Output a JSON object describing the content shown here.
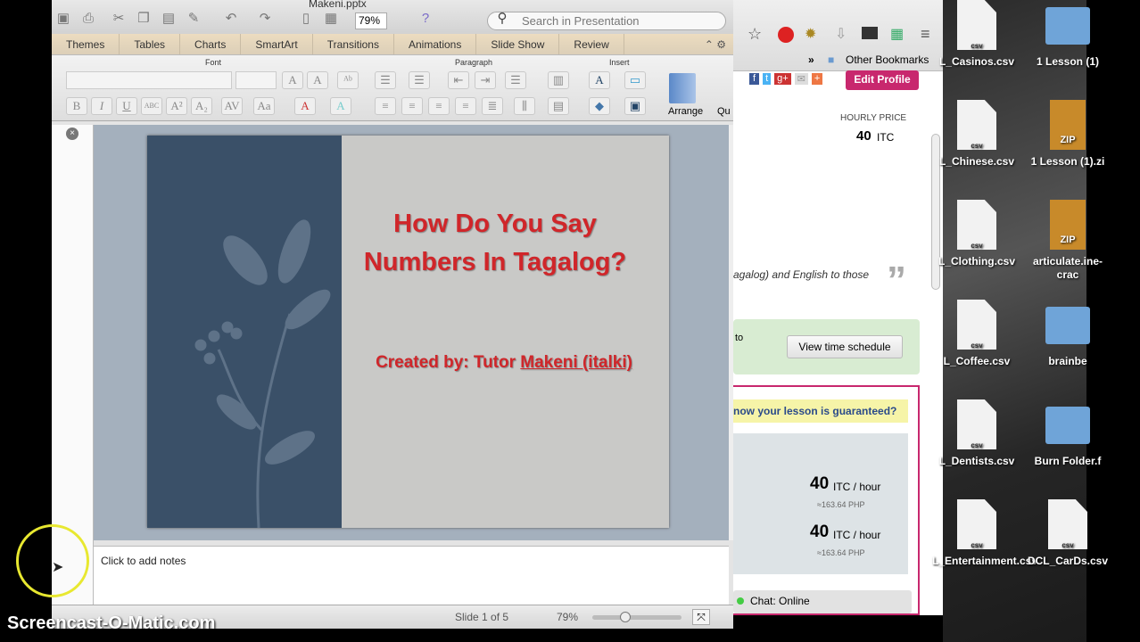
{
  "ppt": {
    "window_title": "Makeni.pptx",
    "zoom": "79%",
    "search_placeholder": "Search in Presentation",
    "tabs": [
      "Themes",
      "Tables",
      "Charts",
      "SmartArt",
      "Transitions",
      "Animations",
      "Slide Show",
      "Review"
    ],
    "groups": {
      "font": "Font",
      "paragraph": "Paragraph",
      "insert": "Insert"
    },
    "arrange": "Arrange",
    "quick": "Qu",
    "slide": {
      "title": "How Do You Say Numbers In Tagalog?",
      "credit_prefix": "Created by: Tutor ",
      "credit_link": "Makeni (italki)"
    },
    "notes_placeholder": "Click to add notes",
    "status": {
      "slide": "Slide 1 of 5",
      "zoom": "79%",
      "zoom_level": 0.35
    }
  },
  "browser": {
    "other_bookmarks": "Other Bookmarks",
    "edit_profile": "Edit Profile",
    "hourly_label": "HOURLY PRICE",
    "hourly_value": "40",
    "hourly_unit": "ITC",
    "quote_fragment": "agalog) and English to those",
    "to": "to",
    "view_schedule": "View time schedule",
    "guarantee": "now your lesson is guaranteed?",
    "prices": [
      {
        "value": "40",
        "unit": "ITC / hour",
        "php": "≈163.64 PHP"
      },
      {
        "value": "40",
        "unit": "ITC / hour",
        "php": "≈163.64 PHP"
      }
    ],
    "chat": "Chat: Online",
    "accent": "#c8286e"
  },
  "desktop": {
    "items": [
      {
        "label": "L_Casinos.csv",
        "type": "csv"
      },
      {
        "label": "1 Lesson (1)",
        "type": "folder"
      },
      {
        "label": "L_Chinese.csv",
        "type": "csv"
      },
      {
        "label": "1 Lesson (1).zi",
        "type": "zip"
      },
      {
        "label": "L_Clothing.csv",
        "type": "csv"
      },
      {
        "label": "articulate.ine-crac",
        "type": "zip"
      },
      {
        "label": "L_Coffee.csv",
        "type": "csv"
      },
      {
        "label": "brainbe",
        "type": "folder"
      },
      {
        "label": "L_Dentists.csv",
        "type": "csv"
      },
      {
        "label": "Burn Folder.f",
        "type": "folder"
      },
      {
        "label": "L_Entertainment.csv",
        "type": "csv"
      },
      {
        "label": "DCL_CarDs.csv",
        "type": "csv"
      }
    ],
    "file_badge": "csv",
    "zip_badge": "ZIP"
  },
  "watermark": "Screencast-O-Matic.com"
}
